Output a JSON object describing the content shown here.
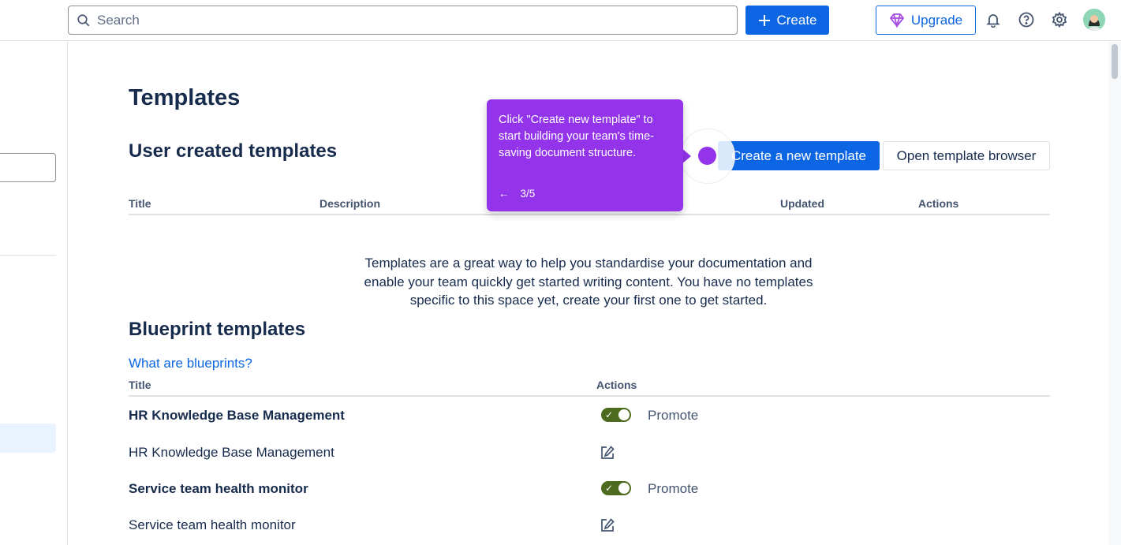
{
  "topbar": {
    "search_placeholder": "Search",
    "create_label": "Create",
    "upgrade_label": "Upgrade",
    "icons": [
      "notification-icon",
      "help-icon",
      "settings-icon"
    ]
  },
  "page": {
    "title": "Templates",
    "user_section_title": "User created templates",
    "create_template_label": "Create a new template",
    "open_browser_label": "Open template browser",
    "user_table_headers": {
      "title": "Title",
      "description": "Description",
      "updated": "Updated",
      "actions": "Actions"
    },
    "empty_message": "Templates are a great way to help you standardise your documentation and enable your team quickly get started writing content. You have no templates specific to this space yet, create your first one to get started.",
    "blueprint_section_title": "Blueprint templates",
    "blueprint_link": "What are blueprints?",
    "blueprint_headers": {
      "title": "Title",
      "actions": "Actions"
    },
    "blueprint_rows": [
      {
        "title": "HR Knowledge Base Management",
        "bold": true,
        "action": "Promote",
        "toggle_on": true
      },
      {
        "title": "HR Knowledge Base Management",
        "bold": false,
        "action": "edit"
      },
      {
        "title": "Service team health monitor",
        "bold": true,
        "action": "Promote",
        "toggle_on": true
      },
      {
        "title": "Service team health monitor",
        "bold": false,
        "action": "edit"
      }
    ]
  },
  "tooltip": {
    "text": "Click \"Create new template\" to start building your team's time-saving document structure.",
    "step": "3/5",
    "back_icon": "arrow-left-icon",
    "color": "#9333ea"
  },
  "colors": {
    "primary": "#0c66e4",
    "toggle_on": "#4c6b1f"
  }
}
